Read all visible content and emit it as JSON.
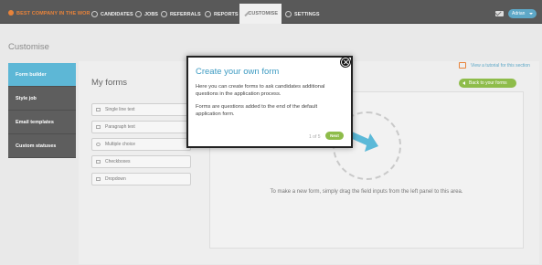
{
  "brand": {
    "name": "BEST COMPANY IN THE WOR"
  },
  "nav": [
    {
      "label": "CANDIDATES",
      "icon": "candidates-icon"
    },
    {
      "label": "JOBS",
      "icon": "jobs-icon"
    },
    {
      "label": "REFERRALS",
      "icon": "referrals-icon"
    },
    {
      "label": "REPORTS",
      "icon": "reports-icon"
    },
    {
      "label": "CUSTOMISE",
      "icon": "pencil-icon",
      "active": true
    },
    {
      "label": "SETTINGS",
      "icon": "settings-icon"
    }
  ],
  "user": {
    "name": "Adrian"
  },
  "page": {
    "title": "Customise"
  },
  "sidebar": {
    "items": [
      {
        "label": "Form builder",
        "active": true
      },
      {
        "label": "Style job"
      },
      {
        "label": "Email templates"
      },
      {
        "label": "Custom statuses"
      }
    ]
  },
  "forms": {
    "title": "My forms",
    "fields": [
      {
        "label": "Single line text",
        "icon": "text-line-icon"
      },
      {
        "label": "Paragraph text",
        "icon": "paragraph-icon"
      },
      {
        "label": "Multiple choice",
        "icon": "radio-icon"
      },
      {
        "label": "Checkboxes",
        "icon": "checkbox-icon"
      },
      {
        "label": "Dropdown",
        "icon": "dropdown-icon"
      }
    ]
  },
  "builder": {
    "tutorial_link": "View a tutorial for this section",
    "back_button": "Back to your forms",
    "drop_hint": "To make a new form, simply drag the field inputs from the left panel to this area."
  },
  "modal": {
    "title": "Create your own form",
    "para1": "Here you can create forms to ask candidates additional questions in the application process.",
    "para2": "Forms are questions added to the end of the default application form.",
    "step": "1 of 5",
    "next": "Next"
  },
  "colors": {
    "accent": "#5db7d6",
    "brand": "#e8833a",
    "button_green": "#8ebc4a",
    "topbar": "#595959"
  }
}
